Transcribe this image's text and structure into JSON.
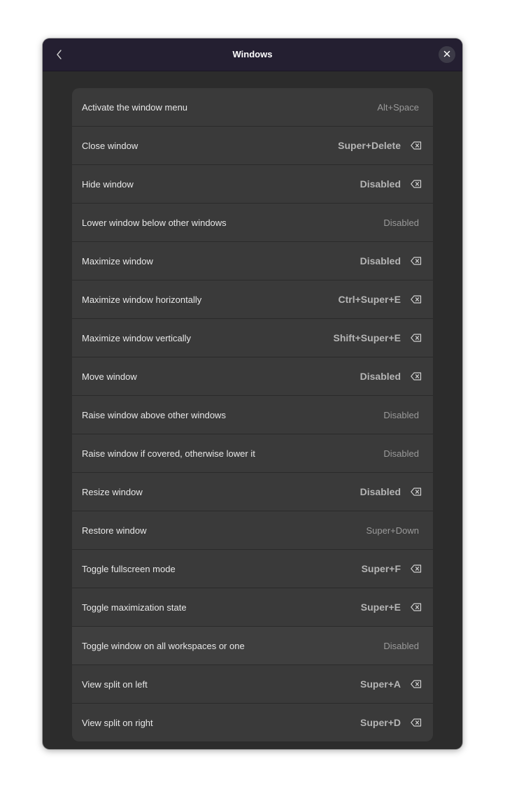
{
  "window": {
    "title": "Windows"
  },
  "icons": {
    "back": "chevron-left-icon",
    "close": "close-icon",
    "reset": "backspace-icon"
  },
  "colors": {
    "titlebar": "#241f31",
    "window_bg": "#2c2c2c",
    "list_bg": "#3a3a3a",
    "label_text": "#e8e8e8",
    "accel_default": "#9a9a9a",
    "accel_custom": "#b5b5b5"
  },
  "shortcuts": [
    {
      "label": "Activate the window menu",
      "accel": "Alt+Space",
      "custom": false
    },
    {
      "label": "Close window",
      "accel": "Super+Delete",
      "custom": true
    },
    {
      "label": "Hide window",
      "accel": "Disabled",
      "custom": true
    },
    {
      "label": "Lower window below other windows",
      "accel": "Disabled",
      "custom": false
    },
    {
      "label": "Maximize window",
      "accel": "Disabled",
      "custom": true
    },
    {
      "label": "Maximize window horizontally",
      "accel": "Ctrl+Super+E",
      "custom": true
    },
    {
      "label": "Maximize window vertically",
      "accel": "Shift+Super+E",
      "custom": true
    },
    {
      "label": "Move window",
      "accel": "Disabled",
      "custom": true
    },
    {
      "label": "Raise window above other windows",
      "accel": "Disabled",
      "custom": false
    },
    {
      "label": "Raise window if covered, otherwise lower it",
      "accel": "Disabled",
      "custom": false
    },
    {
      "label": "Resize window",
      "accel": "Disabled",
      "custom": true
    },
    {
      "label": "Restore window",
      "accel": "Super+Down",
      "custom": false
    },
    {
      "label": "Toggle fullscreen mode",
      "accel": "Super+F",
      "custom": true
    },
    {
      "label": "Toggle maximization state",
      "accel": "Super+E",
      "custom": true
    },
    {
      "label": "Toggle window on all workspaces or one",
      "accel": "Disabled",
      "custom": false,
      "hover": true
    },
    {
      "label": "View split on left",
      "accel": "Super+A",
      "custom": true
    },
    {
      "label": "View split on right",
      "accel": "Super+D",
      "custom": true
    }
  ]
}
